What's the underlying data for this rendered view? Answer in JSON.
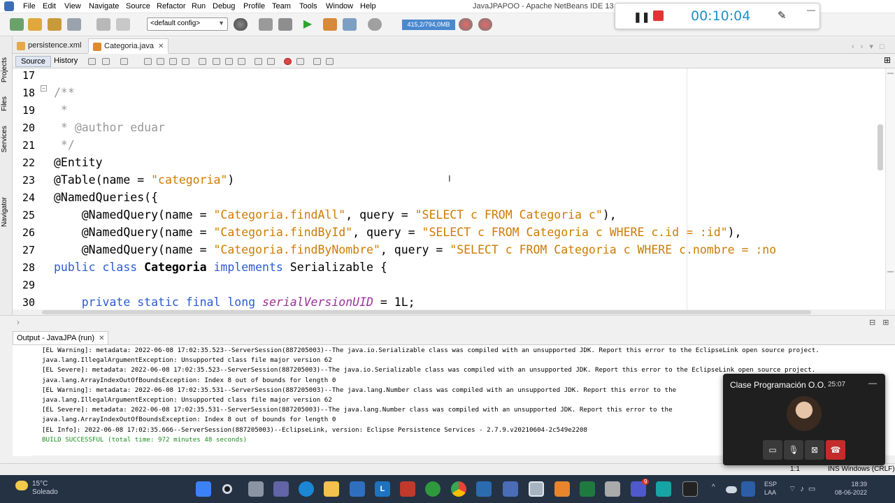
{
  "app": {
    "title": "JavaJPAPOO - Apache NetBeans IDE 13",
    "menu": [
      "File",
      "Edit",
      "View",
      "Navigate",
      "Source",
      "Refactor",
      "Run",
      "Debug",
      "Profile",
      "Team",
      "Tools",
      "Window",
      "Help"
    ]
  },
  "toolbar": {
    "config": "<default config>",
    "memory": "415,2/794,0MB"
  },
  "recorder": {
    "timer": "00:10:04"
  },
  "side_tabs": [
    "Projects",
    "Files",
    "Services",
    "Navigator"
  ],
  "tabs": [
    {
      "label": "persistence.xml",
      "icon": "xml-file-icon"
    },
    {
      "label": "Categoria.java",
      "icon": "java-file-icon"
    }
  ],
  "editor_tabs": {
    "source": "Source",
    "history": "History"
  },
  "editor": {
    "lines": [
      {
        "n": "17"
      },
      {
        "n": "18",
        "parts": [
          {
            "t": "/**",
            "c": "comment"
          }
        ]
      },
      {
        "n": "19",
        "parts": [
          {
            "t": " *",
            "c": "comment"
          }
        ]
      },
      {
        "n": "20",
        "parts": [
          {
            "t": " * ",
            "c": "comment"
          },
          {
            "t": "@author",
            "c": "comment-tag"
          },
          {
            "t": " eduar",
            "c": "comment"
          }
        ]
      },
      {
        "n": "21",
        "parts": [
          {
            "t": " */",
            "c": "comment"
          }
        ]
      },
      {
        "n": "22",
        "parts": [
          {
            "t": "@Entity",
            "c": "ann"
          }
        ]
      },
      {
        "n": "23",
        "parts": [
          {
            "t": "@Table(name = ",
            "c": "ann"
          },
          {
            "t": "\"categoria\"",
            "c": "str"
          },
          {
            "t": ")",
            "c": "ann"
          }
        ]
      },
      {
        "n": "24",
        "parts": [
          {
            "t": "@NamedQueries({",
            "c": "ann"
          }
        ]
      },
      {
        "n": "25",
        "parts": [
          {
            "t": "    @NamedQuery(name = ",
            "c": "ann"
          },
          {
            "t": "\"Categoria.findAll\"",
            "c": "str"
          },
          {
            "t": ", query = ",
            "c": "ann"
          },
          {
            "t": "\"SELECT c FROM Categoria c\"",
            "c": "str"
          },
          {
            "t": "),",
            "c": "ann"
          }
        ]
      },
      {
        "n": "26",
        "parts": [
          {
            "t": "    @NamedQuery(name = ",
            "c": "ann"
          },
          {
            "t": "\"Categoria.findById\"",
            "c": "str"
          },
          {
            "t": ", query = ",
            "c": "ann"
          },
          {
            "t": "\"SELECT c FROM Categoria c WHERE c.id = :id\"",
            "c": "str"
          },
          {
            "t": "),",
            "c": "ann"
          }
        ]
      },
      {
        "n": "27",
        "parts": [
          {
            "t": "    @NamedQuery(name = ",
            "c": "ann"
          },
          {
            "t": "\"Categoria.findByNombre\"",
            "c": "str"
          },
          {
            "t": ", query = ",
            "c": "ann"
          },
          {
            "t": "\"SELECT c FROM Categoria c WHERE c.nombre = :no",
            "c": "str"
          }
        ]
      },
      {
        "n": "28",
        "parts": [
          {
            "t": "public class ",
            "c": "kw"
          },
          {
            "t": "Categoria",
            "c": "bold"
          },
          {
            "t": " implements ",
            "c": "kw"
          },
          {
            "t": "Serializable {",
            "c": "plain"
          }
        ]
      },
      {
        "n": "29"
      },
      {
        "n": "30",
        "parts": [
          {
            "t": "    private static final long ",
            "c": "kw"
          },
          {
            "t": "serialVersionUID",
            "c": "field"
          },
          {
            "t": " = 1L;",
            "c": "plain"
          }
        ]
      }
    ]
  },
  "output": {
    "tab": "Output - JavaJPA (run)",
    "lines": [
      {
        "t": "[EL Warning]: metadata: 2022-06-08 17:02:35.523--ServerSession(887205003)--The java.io.Serializable class was compiled with an unsupported JDK. Report this error to the EclipseLink open source project."
      },
      {
        "t": "java.lang.IllegalArgumentException: Unsupported class file major version 62"
      },
      {
        "t": "[EL Severe]: metadata: 2022-06-08 17:02:35.523--ServerSession(887205003)--The java.io.Serializable class was compiled with an unsupported JDK. Report this error to the EclipseLink open source project."
      },
      {
        "t": "java.lang.ArrayIndexOutOfBoundsException: Index 8 out of bounds for length 0"
      },
      {
        "t": "[EL Warning]: metadata: 2022-06-08 17:02:35.531--ServerSession(887205003)--The java.lang.Number class was compiled with an unsupported JDK. Report this error to the"
      },
      {
        "t": "java.lang.IllegalArgumentException: Unsupported class file major version 62"
      },
      {
        "t": "[EL Severe]: metadata: 2022-06-08 17:02:35.531--ServerSession(887205003)--The java.lang.Number class was compiled with an unsupported JDK. Report this error to the"
      },
      {
        "t": "java.lang.ArrayIndexOutOfBoundsException: Index 8 out of bounds for length 0"
      },
      {
        "t": "[EL Info]: 2022-06-08 17:02:35.666--ServerSession(887205003)--EclipseLink, version: Eclipse Persistence Services - 2.7.9.v20210604-2c549e2208"
      },
      {
        "t": "BUILD SUCCESSFUL (total time: 972 minutes 48 seconds)",
        "ok": true
      }
    ]
  },
  "status": {
    "position": "1:1",
    "mode": "INS",
    "line_endings": "Windows (CRLF)"
  },
  "call": {
    "title": "Clase Programación O.O.",
    "duration": "25:07"
  },
  "taskbar": {
    "weather_temp": "15°C",
    "weather_desc": "Soleado",
    "lang1": "ESP",
    "lang2": "LAA",
    "time": "18:39",
    "date": "08-06-2022",
    "badge": "9"
  },
  "colors": {
    "accent": "#2a5bd0",
    "string": "#ce7b00",
    "field": "#9c2f9c",
    "success": "#1e8c1e",
    "recorder_timer": "#1e90c8",
    "hangup": "#c42b2b"
  }
}
